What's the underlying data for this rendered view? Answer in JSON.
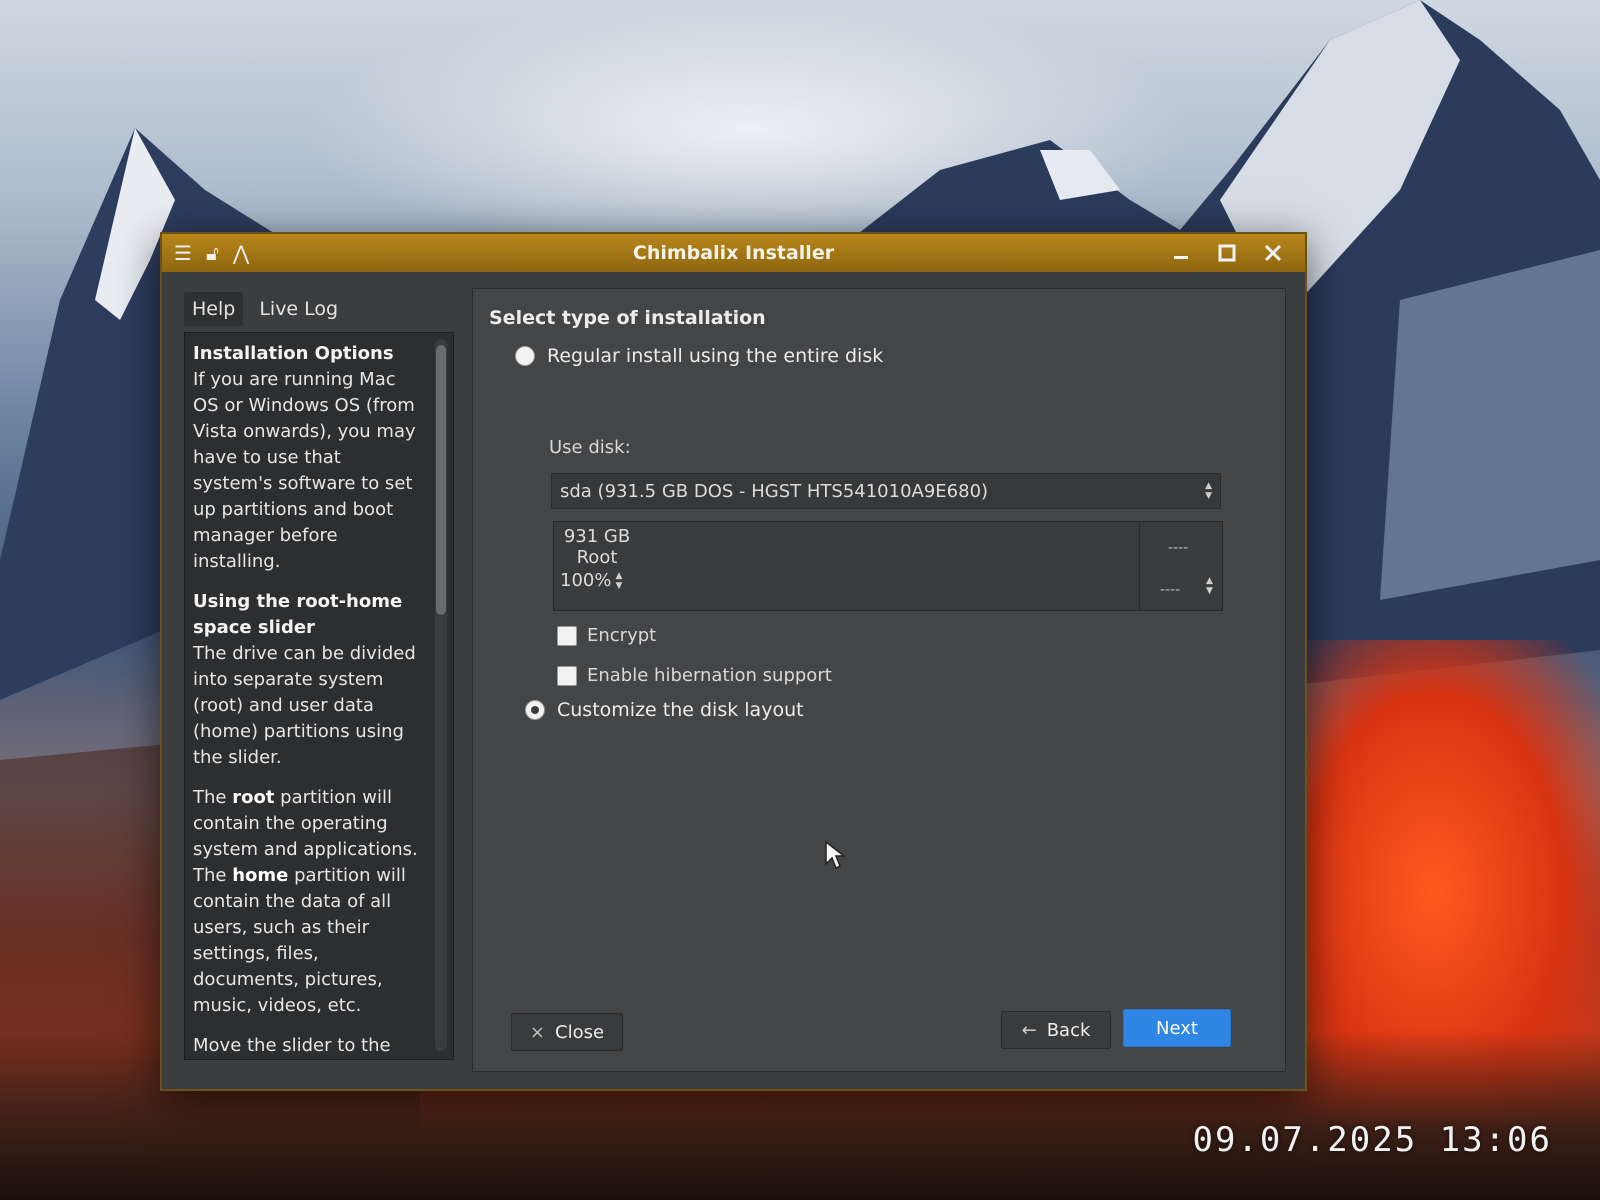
{
  "window": {
    "title": "Chimbalix Installer"
  },
  "help_pane": {
    "tabs": [
      {
        "label": "Help"
      },
      {
        "label": "Live Log"
      }
    ],
    "sections": [
      {
        "heading": "Installation Options",
        "text": "If you are running Mac OS or Windows OS (from Vista onwards), you may have to use that system's software to set up partitions and boot manager before installing."
      },
      {
        "heading": "Using the root-home space slider",
        "text": "The drive can be divided into separate system (root) and user data (home) partitions using the slider."
      }
    ],
    "root_para": {
      "p1": "The ",
      "root": "root",
      "p2": " partition will contain the operating system and applications. The ",
      "home": "home",
      "p3": " partition will contain the data of all users, such as their settings, files, documents, pictures, music, videos, etc."
    },
    "trailing_text": "Move the slider to the"
  },
  "main": {
    "section_title": "Select type of installation",
    "options": {
      "regular_label": "Regular install using the entire disk",
      "custom_label": "Customize the disk layout",
      "selected": "custom"
    },
    "use_disk_label": "Use disk:",
    "disk_select_value": "sda (931.5 GB DOS - HGST HTS541010A9E680)",
    "slider": {
      "size": "931 GB",
      "name": "Root",
      "percent": "100%",
      "right_top": "----",
      "right_bottom": "----"
    },
    "encrypt_label": "Encrypt",
    "hibernation_label": "Enable hibernation support"
  },
  "buttons": {
    "close": "Close",
    "back": "Back",
    "next": "Next"
  },
  "photo_timestamp": "09.07.2025 13:06"
}
